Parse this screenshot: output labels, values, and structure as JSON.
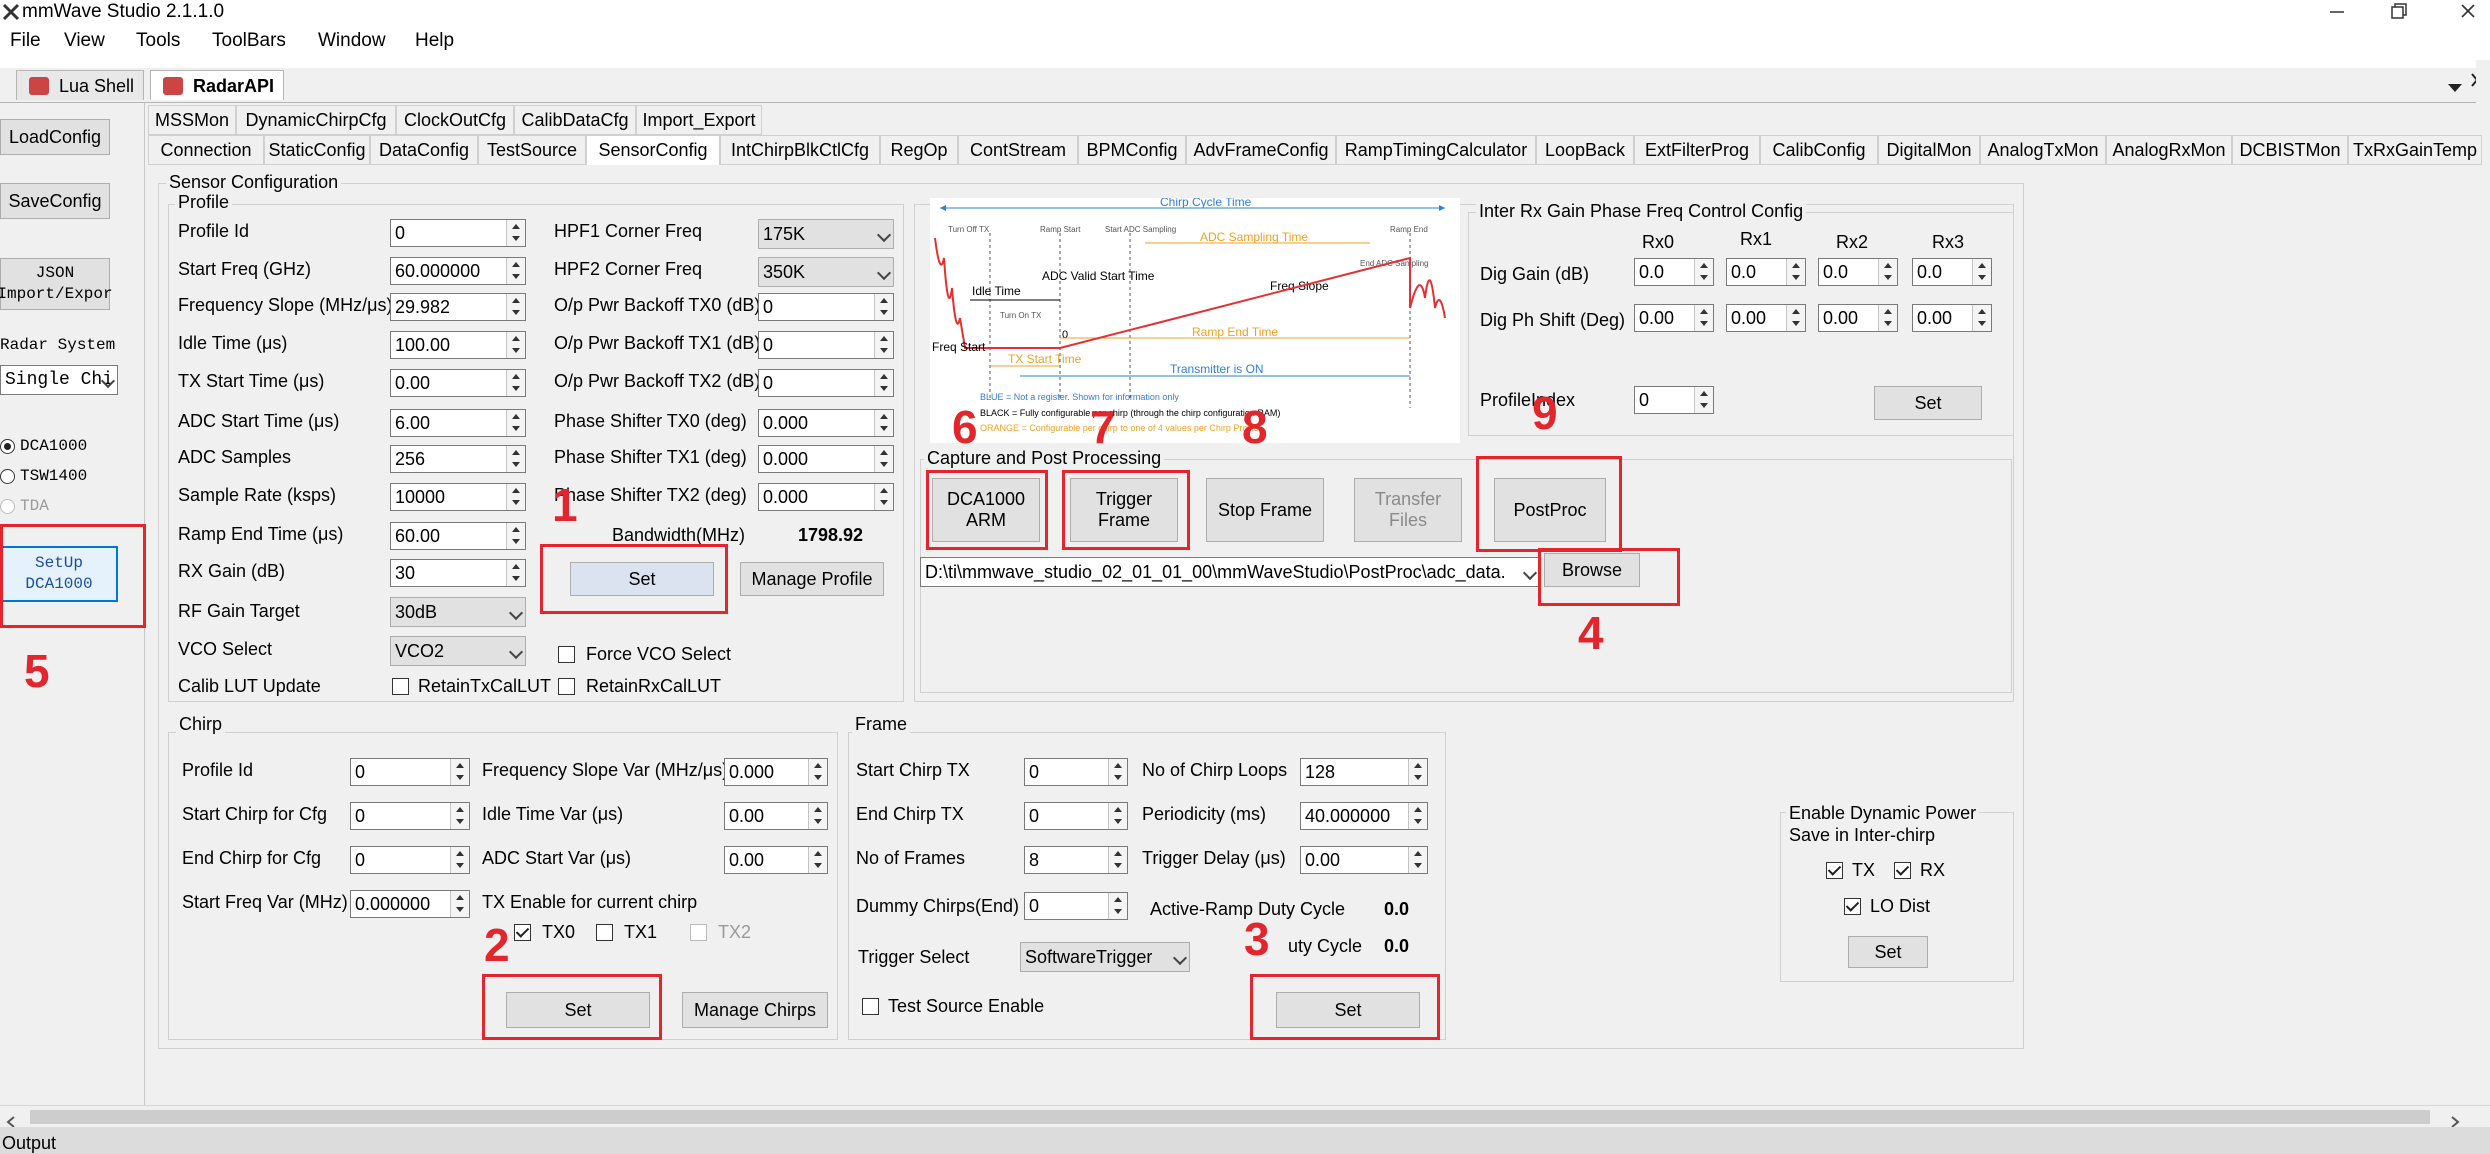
{
  "app": {
    "title": "mmWave Studio 2.1.1.0"
  },
  "menu": [
    "File",
    "View",
    "Tools",
    "ToolBars",
    "Window",
    "Help"
  ],
  "doc_tabs": [
    "Lua Shell",
    "RadarAPI"
  ],
  "left": {
    "load_config": "LoadConfig",
    "save_config": "SaveConfig",
    "json_import_line1": "JSON",
    "json_import_line2": "Import/Expor",
    "radar_system_label": "Radar System",
    "radar_system_value": "Single Chi",
    "radio_dca1000": "DCA1000",
    "radio_tsw1400": "TSW1400",
    "radio_tda": "TDA",
    "setup_line1": "SetUp",
    "setup_line2": "DCA1000"
  },
  "tabs_row1": [
    "MSSMon",
    "DynamicChirpCfg",
    "ClockOutCfg",
    "CalibDataCfg",
    "Import_Export"
  ],
  "tabs_row2": [
    "Connection",
    "StaticConfig",
    "DataConfig",
    "TestSource",
    "SensorConfig",
    "IntChirpBlkCtlCfg",
    "RegOp",
    "ContStream",
    "BPMConfig",
    "AdvFrameConfig",
    "RampTimingCalculator",
    "LoopBack",
    "ExtFilterProg",
    "CalibConfig",
    "DigitalMon",
    "AnalogTxMon",
    "AnalogRxMon",
    "DCBISTMon",
    "TxRxGainTemp"
  ],
  "sensor": {
    "group": "Sensor Configuration",
    "profile": {
      "group": "Profile",
      "fields": [
        {
          "label": "Profile Id",
          "value": "0"
        },
        {
          "label": "Start Freq (GHz)",
          "value": "60.000000"
        },
        {
          "label": "Frequency Slope (MHz/μs)",
          "value": "29.982"
        },
        {
          "label": "Idle Time (μs)",
          "value": "100.00"
        },
        {
          "label": "TX Start Time (μs)",
          "value": "0.00"
        },
        {
          "label": "ADC Start Time (μs)",
          "value": "6.00"
        },
        {
          "label": "ADC Samples",
          "value": "256"
        },
        {
          "label": "Sample Rate (ksps)",
          "value": "10000"
        },
        {
          "label": "Ramp End Time (μs)",
          "value": "60.00"
        },
        {
          "label": "RX Gain (dB)",
          "value": "30"
        }
      ],
      "rf_gain_target_label": "RF Gain Target",
      "rf_gain_target_value": "30dB",
      "vco_select_label": "VCO Select",
      "vco_select_value": "VCO2",
      "calib_lut_label": "Calib LUT Update",
      "retain_tx": "RetainTxCalLUT",
      "retain_rx": "RetainRxCalLUT",
      "force_vco": "Force VCO Select",
      "hpf1_label": "HPF1 Corner Freq",
      "hpf1_value": "175K",
      "hpf2_label": "HPF2 Corner Freq",
      "hpf2_value": "350K",
      "right_fields": [
        {
          "label": "O/p Pwr Backoff TX0 (dB)",
          "value": "0"
        },
        {
          "label": "O/p Pwr Backoff TX1 (dB)",
          "value": "0"
        },
        {
          "label": "O/p Pwr Backoff TX2 (dB)",
          "value": "0"
        },
        {
          "label": "Phase Shifter TX0 (deg)",
          "value": "0.000"
        },
        {
          "label": "Phase Shifter TX1 (deg)",
          "value": "0.000"
        },
        {
          "label": "Phase Shifter TX2 (deg)",
          "value": "0.000"
        }
      ],
      "bandwidth_label": "Bandwidth(MHz)",
      "bandwidth_value": "1798.92",
      "set": "Set",
      "manage": "Manage Profile"
    }
  },
  "diagram": {
    "chirp_cycle": "Chirp Cycle Time",
    "turn_off_tx": "Turn Off TX",
    "ramp_start": "Ramp Start",
    "start_adc": "Start ADC Sampling",
    "adc_sampling": "ADC Sampling Time",
    "ramp_end": "Ramp End",
    "end_adc": "End ADC Sampling",
    "adc_valid": "ADC Valid Start Time",
    "idle_time": "Idle Time",
    "freq_slope": "Freq Slope",
    "turn_on_tx": "Turn On TX",
    "zero": "0",
    "ramp_end_time": "Ramp End Time",
    "freq_start": "Freq Start",
    "tx_start": "TX Start Time",
    "transmitter_on": "Transmitter is ON",
    "legend_blue": "BLUE = Not a register. Shown for information only",
    "legend_black": "BLACK = Fully configurable per chirp (through the chirp configuration RAM)",
    "legend_orange": "ORANGE = Configurable per chirp to one of 4 values per Chirp Profile"
  },
  "inter_rx": {
    "group": "Inter Rx Gain Phase Freq Control Config",
    "rx_headers": [
      "Rx0",
      "Rx1",
      "Rx2",
      "Rx3"
    ],
    "dig_gain_label": "Dig Gain (dB)",
    "dig_gain_values": [
      "0.0",
      "0.0",
      "0.0",
      "0.0"
    ],
    "dig_ph_label": "Dig Ph Shift (Deg)",
    "dig_ph_values": [
      "0.00",
      "0.00",
      "0.00",
      "0.00"
    ],
    "profile_index_label": "ProfileIndex",
    "profile_index_value": "0",
    "set": "Set"
  },
  "capture": {
    "group": "Capture and Post Processing",
    "dca_line1": "DCA1000",
    "dca_line2": "ARM",
    "trigger_line1": "Trigger",
    "trigger_line2": "Frame",
    "stop_frame": "Stop Frame",
    "transfer_line1": "Transfer",
    "transfer_line2": "Files",
    "postproc": "PostProc",
    "path": "D:\\ti\\mmwave_studio_02_01_01_00\\mmWaveStudio\\PostProc\\adc_data.",
    "browse": "Browse"
  },
  "chirp": {
    "group": "Chirp",
    "left_fields": [
      {
        "label": "Profile Id",
        "value": "0"
      },
      {
        "label": "Start Chirp for Cfg",
        "value": "0"
      },
      {
        "label": "End Chirp for Cfg",
        "value": "0"
      },
      {
        "label": "Start Freq Var (MHz)",
        "value": "0.000000"
      }
    ],
    "right_fields": [
      {
        "label": "Frequency Slope Var (MHz/μs)",
        "value": "0.000"
      },
      {
        "label": "Idle Time Var (μs)",
        "value": "0.00"
      },
      {
        "label": "ADC Start Var (μs)",
        "value": "0.00"
      }
    ],
    "tx_enable_label": "TX Enable for current chirp",
    "tx0": "TX0",
    "tx1": "TX1",
    "tx2": "TX2",
    "set": "Set",
    "manage": "Manage Chirps"
  },
  "frame": {
    "group": "Frame",
    "left_fields": [
      {
        "label": "Start Chirp TX",
        "value": "0"
      },
      {
        "label": "End Chirp TX",
        "value": "0"
      },
      {
        "label": "No of Frames",
        "value": "8"
      },
      {
        "label": "Dummy Chirps(End)",
        "value": "0"
      }
    ],
    "right_fields": [
      {
        "label": "No of Chirp Loops",
        "value": "128"
      },
      {
        "label": "Periodicity (ms)",
        "value": "40.000000"
      },
      {
        "label": "Trigger Delay (μs)",
        "value": "0.00"
      }
    ],
    "active_ramp_label": "Active-Ramp Duty Cycle",
    "active_ramp_value": "0.0",
    "duty_label": "uty Cycle",
    "duty_value": "0.0",
    "trigger_select_label": "Trigger Select",
    "trigger_select_value": "SoftwareTrigger",
    "test_source": "Test Source Enable",
    "set": "Set"
  },
  "dynpower": {
    "title_line1": "Enable Dynamic Power",
    "title_line2": "Save in Inter-chirp",
    "tx": "TX",
    "rx": "RX",
    "lo_dist": "LO Dist",
    "set": "Set"
  },
  "annotations": [
    "1",
    "2",
    "3",
    "4",
    "5",
    "6",
    "7",
    "8",
    "9"
  ],
  "output_label": "Output",
  "colors": {
    "annotation_red": "#e3262c",
    "diagram_blue": "#2f7fd6",
    "diagram_orange": "#f0a020",
    "diagram_red": "#e53030"
  }
}
